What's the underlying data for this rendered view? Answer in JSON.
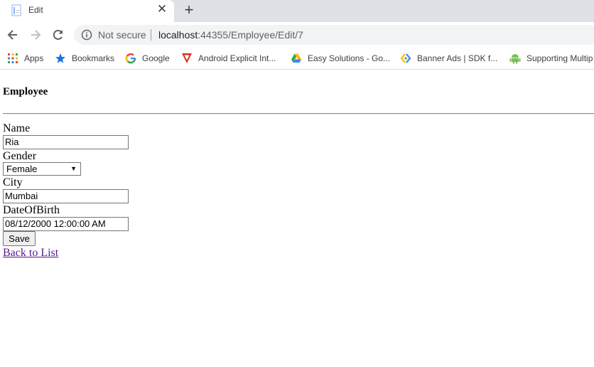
{
  "browser": {
    "tab": {
      "title": "Edit",
      "close": "✕"
    },
    "new_tab": "+",
    "omnibox": {
      "security": "Not secure",
      "url_host": "localhost",
      "url_rest": ":44355/Employee/Edit/7"
    },
    "bookmarks": [
      {
        "label": "Apps",
        "icon": "apps-grid-icon"
      },
      {
        "label": "Bookmarks",
        "icon": "star-icon"
      },
      {
        "label": "Google",
        "icon": "google-icon"
      },
      {
        "label": "Android Explicit Int...",
        "icon": "android-explicit-icon"
      },
      {
        "label": "Easy Solutions - Go...",
        "icon": "drive-icon"
      },
      {
        "label": "Banner Ads  |  SDK f...",
        "icon": "ads-icon"
      },
      {
        "label": "Supporting Multip",
        "icon": "android-icon"
      }
    ]
  },
  "form": {
    "heading": "Employee",
    "name_label": "Name",
    "name_value": "Ria",
    "gender_label": "Gender",
    "gender_value": "Female",
    "city_label": "City",
    "city_value": "Mumbai",
    "dob_label": "DateOfBirth",
    "dob_value": "08/12/2000 12:00:00 AM",
    "save_label": "Save",
    "back_link": "Back to List"
  }
}
